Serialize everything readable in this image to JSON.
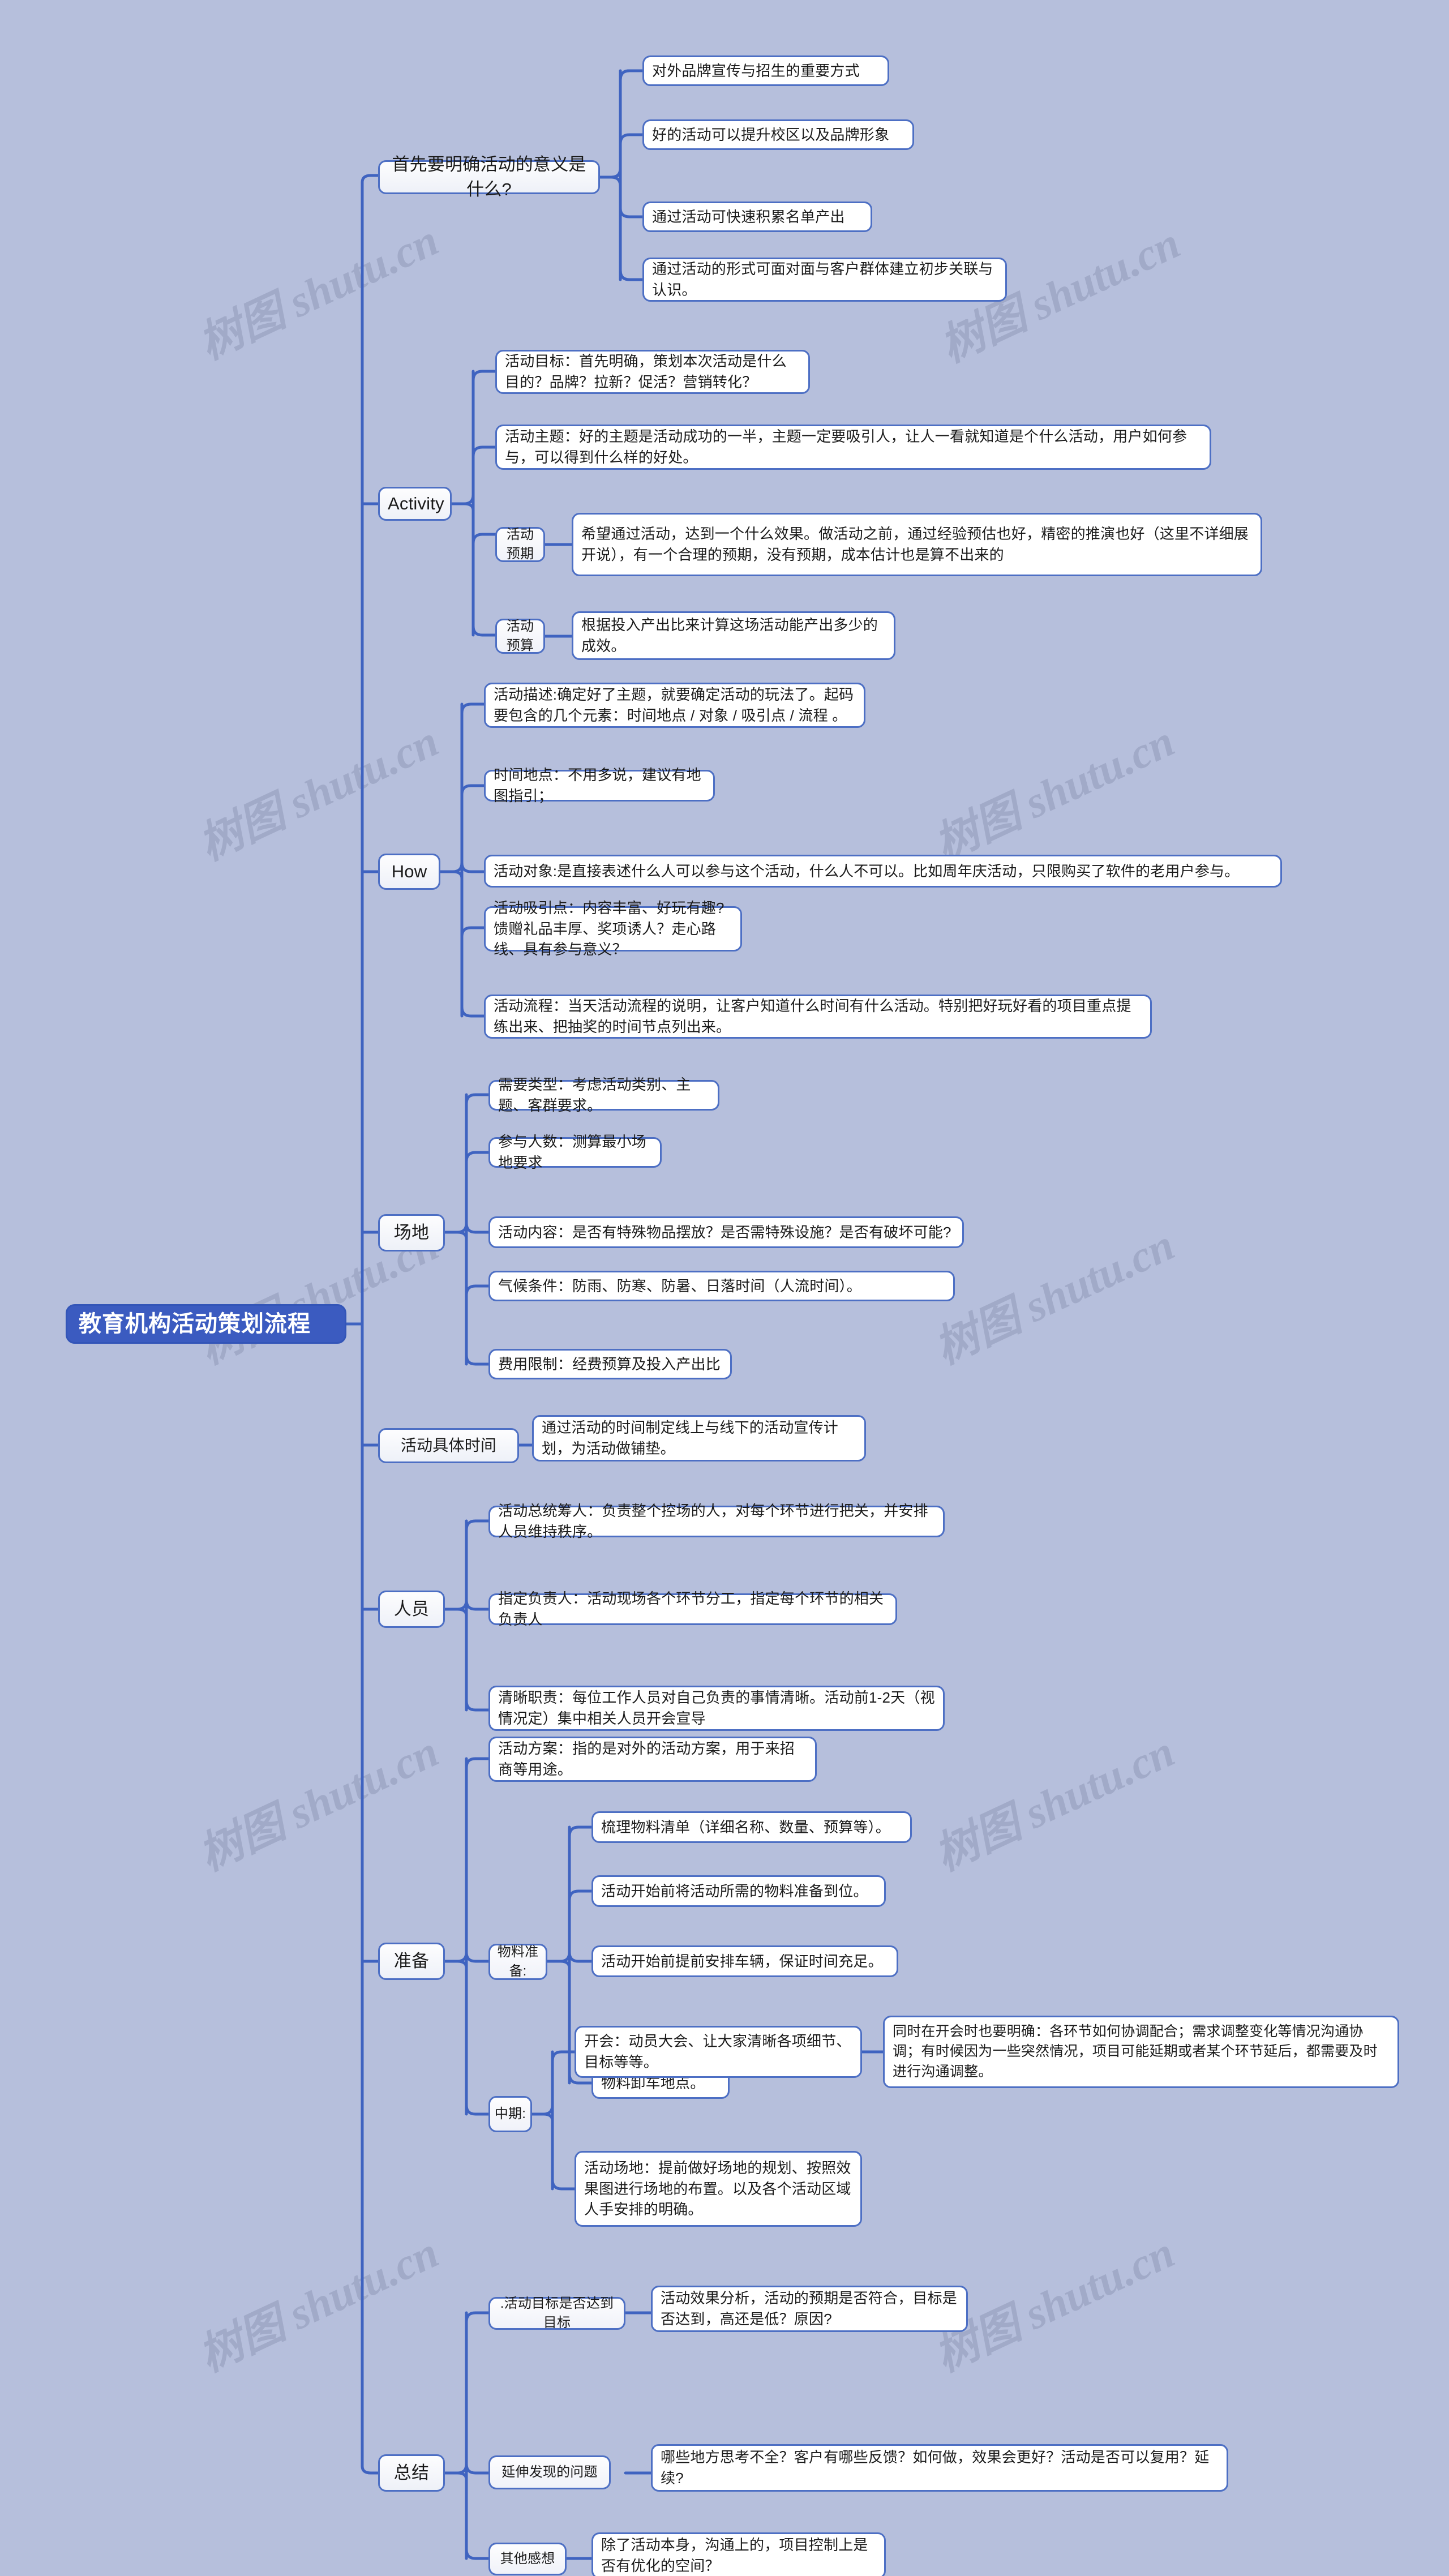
{
  "title": "教育机构活动策划流程",
  "watermarks": [
    "树图 shutu.cn"
  ],
  "root": {
    "label": "教育机构活动策划流程"
  },
  "branches": [
    {
      "id": "meaning",
      "label": "首先要明确活动的意义是什么?",
      "children": [
        {
          "label": "对外品牌宣传与招生的重要方式"
        },
        {
          "label": "好的活动可以提升校区以及品牌形象"
        },
        {
          "label": "通过活动可快速积累名单产出"
        },
        {
          "label": "通过活动的形式可面对面与客户群体建立初步关联与认识。"
        }
      ]
    },
    {
      "id": "activity",
      "label": "Activity",
      "children": [
        {
          "label": "活动目标：首先明确，策划本次活动是什么目的？品牌？拉新？促活？营销转化？"
        },
        {
          "label": "活动主题：好的主题是活动成功的一半，主题一定要吸引人，让人一看就知道是个什么活动，用户如何参与，可以得到什么样的好处。"
        },
        {
          "label": "活动预期",
          "children": [
            {
              "label": "希望通过活动，达到一个什么效果。做活动之前，通过经验预估也好，精密的推演也好（这里不详细展开说），有一个合理的预期，没有预期，成本估计也是算不出来的"
            }
          ]
        },
        {
          "label": "活动预算",
          "children": [
            {
              "label": "根据投入产出比来计算这场活动能产出多少的成效。"
            }
          ]
        }
      ]
    },
    {
      "id": "how",
      "label": "How",
      "children": [
        {
          "label": "活动描述:确定好了主题，就要确定活动的玩法了。起码要包含的几个元素：时间地点 / 对象 / 吸引点 / 流程 。"
        },
        {
          "label": "时间地点：不用多说，建议有地图指引；"
        },
        {
          "label": "活动对象:是直接表述什么人可以参与这个活动，什么人不可以。比如周年庆活动，只限购买了软件的老用户参与。"
        },
        {
          "label": "活动吸引点：内容丰富、好玩有趣?馈赠礼品丰厚、奖项诱人？走心路线、具有参与意义？"
        },
        {
          "label": "活动流程：当天活动流程的说明，让客户知道什么时间有什么活动。特别把好玩好看的项目重点提练出来、把抽奖的时间节点列出来。"
        }
      ]
    },
    {
      "id": "venue",
      "label": "场地",
      "children": [
        {
          "label": "需要类型：考虑活动类别、主题、客群要求。"
        },
        {
          "label": "参与人数：测算最小场地要求"
        },
        {
          "label": "活动内容：是否有特殊物品摆放？是否需特殊设施？是否有破坏可能?"
        },
        {
          "label": "气候条件：防雨、防寒、防暑、日落时间（人流时间）。"
        },
        {
          "label": "费用限制：经费预算及投入产出比"
        }
      ]
    },
    {
      "id": "time",
      "label": "活动具体时间",
      "children": [
        {
          "label": "通过活动的时间制定线上与线下的活动宣传计划，为活动做铺垫。"
        }
      ]
    },
    {
      "id": "staff",
      "label": "人员",
      "children": [
        {
          "label": "活动总统筹人：负责整个控场的人，对每个环节进行把关，并安排人员维持秩序。"
        },
        {
          "label": "指定负责人：活动现场各个环节分工，指定每个环节的相关负责人"
        },
        {
          "label": "清晰职责：每位工作人员对自己负责的事情清晰。活动前1-2天（视情况定）集中相关人员开会宣导"
        }
      ]
    },
    {
      "id": "prepare",
      "label": "准备",
      "children": [
        {
          "label": "活动方案：指的是对外的活动方案，用于来招商等用途。"
        },
        {
          "label": "物料准备:",
          "children": [
            {
              "label": "梳理物料清单（详细名称、数量、预算等）。"
            },
            {
              "label": "活动开始前将活动所需的物料准备到位。"
            },
            {
              "label": "活动开始前提前安排车辆，保证时间充足。"
            },
            {
              "label": "物料卸车地点。"
            }
          ]
        },
        {
          "label": "中期:",
          "children": [
            {
              "label": "开会：动员大会、让大家清晰各项细节、目标等等。",
              "children": [
                {
                  "label": "同时在开会时也要明确：各环节如何协调配合；需求调整变化等情况沟通协调；有时候因为一些突然情况，项目可能延期或者某个环节延后，都需要及时进行沟通调整。"
                }
              ]
            },
            {
              "label": "活动场地：提前做好场地的规划、按照效果图进行场地的布置。以及各个活动区域人手安排的明确。"
            }
          ]
        }
      ]
    },
    {
      "id": "summary",
      "label": "总结",
      "children": [
        {
          "label": ".活动目标是否达到目标",
          "children": [
            {
              "label": "活动效果分析，活动的预期是否符合，目标是否达到，高还是低？原因?"
            }
          ]
        },
        {
          "label": "延伸发现的问题",
          "children": [
            {
              "label": "哪些地方思考不全？客户有哪些反馈？如何做，效果会更好？活动是否可以复用？延续?"
            }
          ]
        },
        {
          "label": "其他感想",
          "children": [
            {
              "label": "除了活动本身，沟通上的，项目控制上是否有优化的空间？"
            }
          ]
        }
      ]
    }
  ],
  "colors": {
    "background": "#b6bfdc",
    "line": "#3f63c0",
    "node_border": "#4d6fc4",
    "root_fill": "#3b5bc0",
    "leaf_fill": "#ffffff"
  }
}
